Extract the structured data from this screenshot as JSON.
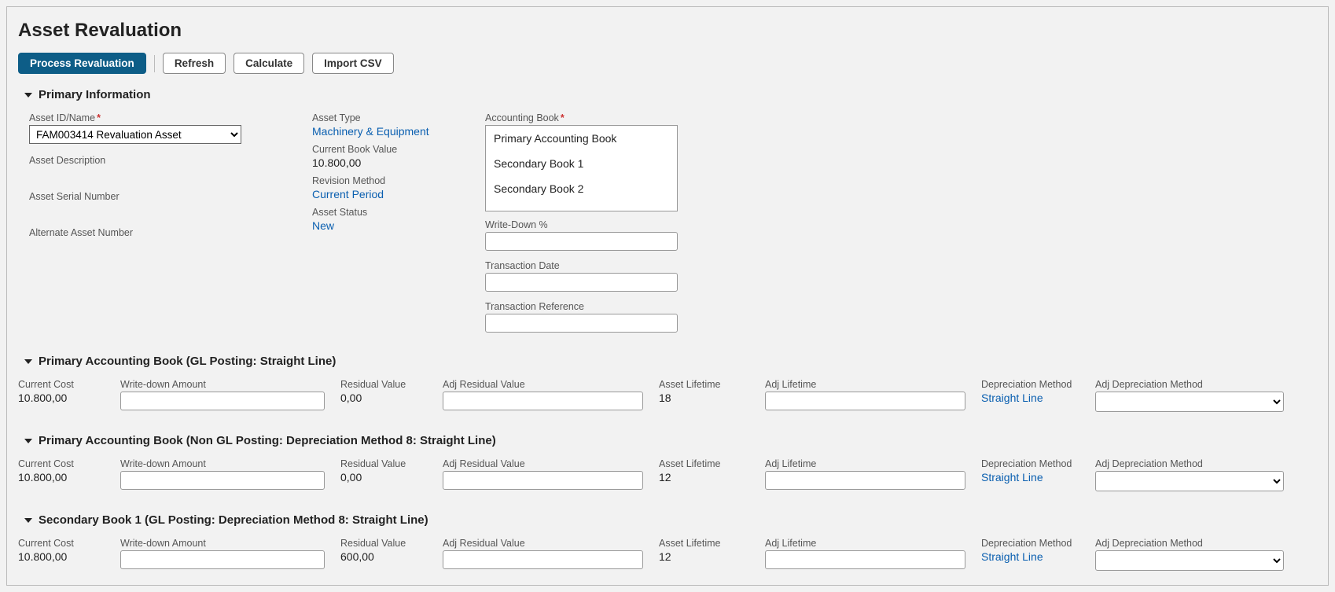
{
  "page_title": "Asset Revaluation",
  "toolbar": {
    "process": "Process Revaluation",
    "refresh": "Refresh",
    "calculate": "Calculate",
    "import": "Import CSV"
  },
  "primary_info": {
    "section_title": "Primary Information",
    "labels": {
      "asset_id": "Asset ID/Name",
      "asset_desc": "Asset Description",
      "asset_serial": "Asset Serial Number",
      "alternate_asset": "Alternate Asset Number",
      "asset_type": "Asset Type",
      "current_book_value": "Current Book Value",
      "revision_method": "Revision Method",
      "asset_status": "Asset Status",
      "accounting_book": "Accounting Book",
      "write_down_pct": "Write-Down %",
      "transaction_date": "Transaction Date",
      "transaction_ref": "Transaction Reference"
    },
    "values": {
      "asset_id": "FAM003414 Revaluation Asset",
      "asset_type": "Machinery & Equipment",
      "current_book_value": "10.800,00",
      "revision_method": "Current Period",
      "asset_status": "New",
      "write_down_pct": "",
      "transaction_date": "",
      "transaction_ref": ""
    },
    "accounting_book_options": [
      "Primary Accounting Book",
      "Secondary Book 1",
      "Secondary Book 2"
    ]
  },
  "book_labels": {
    "current_cost": "Current Cost",
    "write_down_amount": "Write-down Amount",
    "residual_value": "Residual Value",
    "adj_residual_value": "Adj Residual Value",
    "asset_lifetime": "Asset Lifetime",
    "adj_lifetime": "Adj Lifetime",
    "depreciation_method": "Depreciation Method",
    "adj_depreciation_method": "Adj Depreciation Method"
  },
  "books": [
    {
      "title": "Primary Accounting Book (GL Posting: Straight Line)",
      "current_cost": "10.800,00",
      "write_down_amount": "",
      "residual_value": "0,00",
      "adj_residual_value": "",
      "asset_lifetime": "18",
      "adj_lifetime": "",
      "depreciation_method": "Straight Line",
      "adj_depreciation_method": ""
    },
    {
      "title": "Primary Accounting Book (Non GL Posting: Depreciation Method 8: Straight Line)",
      "current_cost": "10.800,00",
      "write_down_amount": "",
      "residual_value": "0,00",
      "adj_residual_value": "",
      "asset_lifetime": "12",
      "adj_lifetime": "",
      "depreciation_method": "Straight Line",
      "adj_depreciation_method": ""
    },
    {
      "title": "Secondary Book 1 (GL Posting: Depreciation Method 8: Straight Line)",
      "current_cost": "10.800,00",
      "write_down_amount": "",
      "residual_value": "600,00",
      "adj_residual_value": "",
      "asset_lifetime": "12",
      "adj_lifetime": "",
      "depreciation_method": "Straight Line",
      "adj_depreciation_method": ""
    }
  ]
}
